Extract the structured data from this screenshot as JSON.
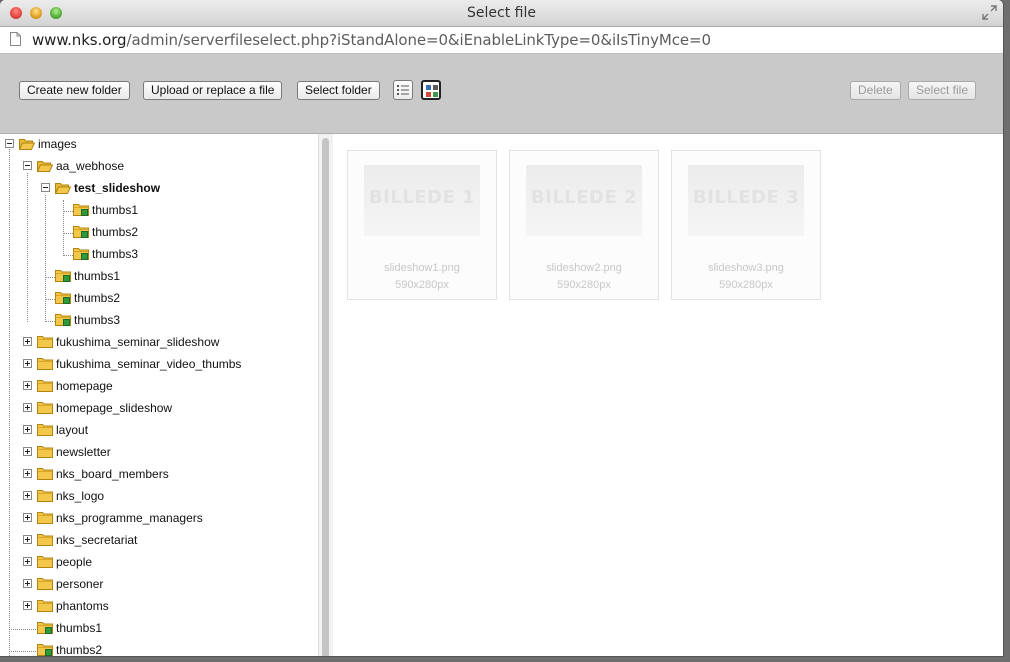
{
  "window": {
    "title": "Select file",
    "url_host": "www.nks.org",
    "url_path": "/admin/serverfileselect.php?iStandAlone=0&iEnableLinkType=0&iIsTinyMce=0"
  },
  "toolbar": {
    "create_folder": "Create new folder",
    "upload": "Upload or replace a file",
    "select_folder": "Select folder",
    "view_list_icon": "list-view-icon",
    "view_thumbs_icon": "thumbnail-view-icon",
    "delete": "Delete",
    "select_file": "Select file"
  },
  "tree": [
    {
      "label": "images",
      "state": "expanded",
      "bold": false
    },
    {
      "label": "aa_webhose",
      "state": "expanded",
      "bold": false
    },
    {
      "label": "test_slideshow",
      "state": "expanded",
      "bold": true
    },
    {
      "label": "thumbs1",
      "state": "leaf",
      "bold": false
    },
    {
      "label": "thumbs2",
      "state": "leaf",
      "bold": false
    },
    {
      "label": "thumbs3",
      "state": "leaf",
      "bold": false
    },
    {
      "label": "thumbs1",
      "state": "leaf",
      "bold": false
    },
    {
      "label": "thumbs2",
      "state": "leaf",
      "bold": false
    },
    {
      "label": "thumbs3",
      "state": "leaf",
      "bold": false
    },
    {
      "label": "fukushima_seminar_slideshow",
      "state": "collapsed",
      "bold": false
    },
    {
      "label": "fukushima_seminar_video_thumbs",
      "state": "collapsed",
      "bold": false
    },
    {
      "label": "homepage",
      "state": "collapsed",
      "bold": false
    },
    {
      "label": "homepage_slideshow",
      "state": "collapsed",
      "bold": false
    },
    {
      "label": "layout",
      "state": "collapsed",
      "bold": false
    },
    {
      "label": "newsletter",
      "state": "collapsed",
      "bold": false
    },
    {
      "label": "nks_board_members",
      "state": "collapsed",
      "bold": false
    },
    {
      "label": "nks_logo",
      "state": "collapsed",
      "bold": false
    },
    {
      "label": "nks_programme_managers",
      "state": "collapsed",
      "bold": false
    },
    {
      "label": "nks_secretariat",
      "state": "collapsed",
      "bold": false
    },
    {
      "label": "people",
      "state": "collapsed",
      "bold": false
    },
    {
      "label": "personer",
      "state": "collapsed",
      "bold": false
    },
    {
      "label": "phantoms",
      "state": "collapsed",
      "bold": false
    },
    {
      "label": "thumbs1",
      "state": "leaf",
      "bold": false
    },
    {
      "label": "thumbs2",
      "state": "leaf",
      "bold": false
    }
  ],
  "files": [
    {
      "thumb_text": "BILLEDE 1",
      "name": "slideshow1.png",
      "size": "590x280px"
    },
    {
      "thumb_text": "BILLEDE 2",
      "name": "slideshow2.png",
      "size": "590x280px"
    },
    {
      "thumb_text": "BILLEDE 3",
      "name": "slideshow3.png",
      "size": "590x280px"
    }
  ],
  "colors": {
    "toolbar_bg": "#c9c9c9",
    "folder_yellow": "#f3c74a",
    "leaf_badge_green": "#2e9a3a"
  }
}
